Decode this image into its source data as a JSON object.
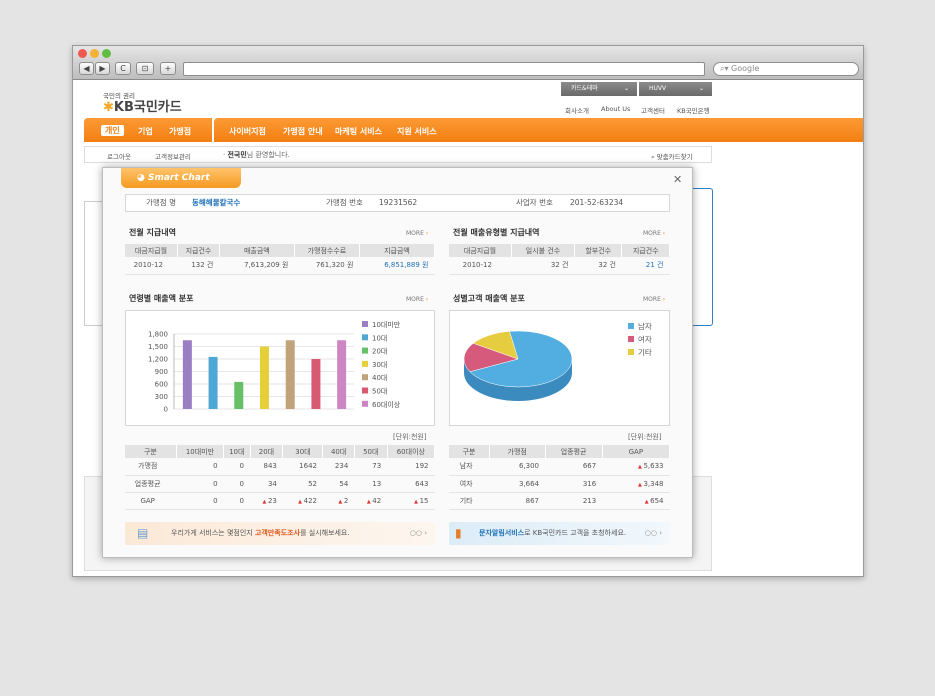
{
  "browser": {
    "search_placeholder": "Google",
    "nav_back": "◀",
    "nav_fwd": "▶",
    "reload": "C",
    "add": "+"
  },
  "site": {
    "logo_tagline": "국민의 권리",
    "logo_name": "KB국민카드",
    "top_buttons": [
      "카드&테마",
      "HUVV"
    ],
    "top_links": [
      "회사소개",
      "About Us",
      "고객센터",
      "KB국민은행"
    ],
    "main_nav": [
      "개인",
      "기업",
      "가맹점"
    ],
    "sub_nav": [
      "사이버지점",
      "가맹점 안내",
      "마케팅 서비스",
      "지원 서비스"
    ],
    "logout": "로그아웃",
    "info_manage": "고객정보관리",
    "welcome_name": "전국민",
    "welcome_suffix": "님 환영합니다.",
    "find_card": "맞춤카드찾기"
  },
  "modal": {
    "badge": "Smart Chart",
    "close": "✕",
    "merchant_name_label": "가맹점 명",
    "merchant_name": "동해해물칼국수",
    "merchant_no_label": "가맹점 번호",
    "merchant_no": "19231562",
    "biz_no_label": "사업자 번호",
    "biz_no": "201-52-63234",
    "more": "MORE",
    "unit": "[단위:천원]",
    "sec1": {
      "title": "전월 지급내역",
      "headers": [
        "대금지급월",
        "지급건수",
        "매출금액",
        "가맹점수수료",
        "지급금액"
      ],
      "row": [
        "2010-12",
        "132 건",
        "7,613,209 원",
        "761,320 원",
        "6,851,889 원"
      ]
    },
    "sec2": {
      "title": "전월 매출유형별 지급내역",
      "headers": [
        "대금지급월",
        "일시불 건수",
        "할부건수",
        "지급건수"
      ],
      "row": [
        "2010-12",
        "32 건",
        "32 건",
        "21 건"
      ]
    },
    "sec3": {
      "title": "연령별 매출액 분포"
    },
    "sec4": {
      "title": "성별고객 매출액 분포"
    },
    "age_table": {
      "headers": [
        "구분",
        "10대미만",
        "10대",
        "20대",
        "30대",
        "40대",
        "50대",
        "60대이상"
      ],
      "rows": [
        [
          "가맹점",
          "0",
          "0",
          "843",
          "1642",
          "234",
          "73",
          "192"
        ],
        [
          "업종평균",
          "0",
          "0",
          "34",
          "52",
          "54",
          "13",
          "643"
        ],
        [
          "GAP",
          "0",
          "0",
          "23",
          "422",
          "2",
          "42",
          "15"
        ]
      ]
    },
    "gender_table": {
      "headers": [
        "구분",
        "가맹점",
        "업종평균",
        "GAP"
      ],
      "rows": [
        [
          "남자",
          "6,300",
          "667",
          "5,633"
        ],
        [
          "여자",
          "3,664",
          "316",
          "3,348"
        ],
        [
          "기타",
          "867",
          "213",
          "654"
        ]
      ]
    },
    "banner1": {
      "pre": "우리가게 서비스는 몇점인지 ",
      "em": "고객만족도조사",
      "post": "를 실시해보세요."
    },
    "banner2": {
      "em": "문자알림서비스",
      "post": "로 KB국민카드 고객을 초청하세요."
    },
    "banner_more": "○○ ›"
  },
  "colors": {
    "orange": "#f47f12",
    "blue": "#1d6fb8",
    "age": [
      "#9a7fc2",
      "#4fa7d5",
      "#66c067",
      "#e7cf3a",
      "#c1a27b",
      "#d85a72",
      "#cc86c4"
    ],
    "pie": [
      "#52aee0",
      "#d65a7c",
      "#e6cc3f"
    ]
  },
  "chart_data": [
    {
      "type": "bar",
      "title": "연령별 매출액 분포",
      "categories": [
        "10대미만",
        "10대",
        "20대",
        "30대",
        "40대",
        "50대",
        "60대이상"
      ],
      "values": [
        1650,
        1250,
        650,
        1500,
        1650,
        1200,
        1650
      ],
      "ylim": [
        0,
        1800
      ],
      "yticks": [
        0,
        300,
        600,
        900,
        1200,
        1500,
        1800
      ],
      "legend": "right"
    },
    {
      "type": "pie",
      "title": "성별고객 매출액 분포",
      "categories": [
        "남자",
        "여자",
        "기타"
      ],
      "values": [
        70,
        17,
        13
      ],
      "legend": "right"
    }
  ]
}
